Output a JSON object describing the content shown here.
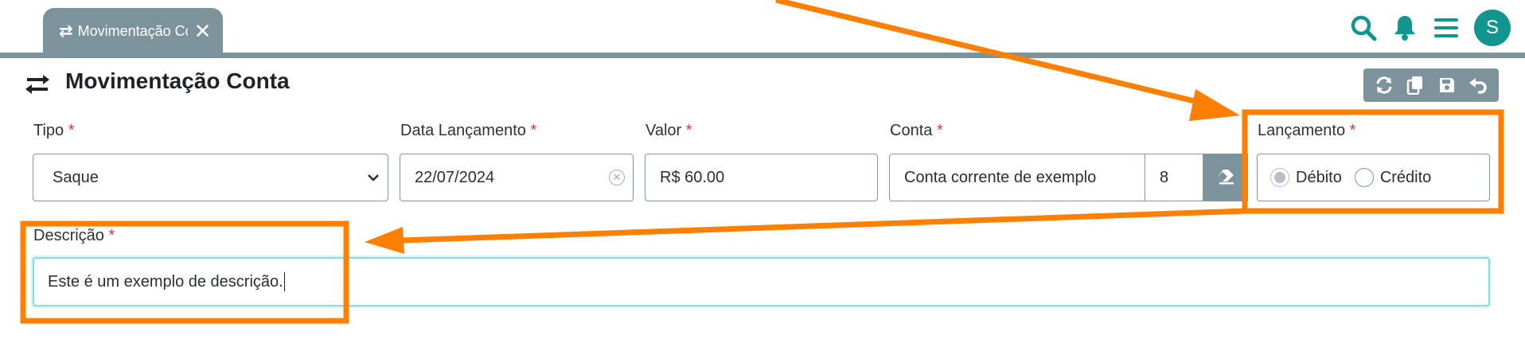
{
  "tab": {
    "label": "Movimentação Conta",
    "close": "✕"
  },
  "top_icons": [
    "search-icon",
    "bell-icon",
    "menu-icon"
  ],
  "user": {
    "avatar_letter": "S"
  },
  "page": {
    "title": "Movimentação Conta",
    "icon": "transfer-arrows-icon"
  },
  "toolbar": [
    "refresh-icon",
    "copy-icon",
    "save-icon",
    "undo-icon"
  ],
  "form": {
    "tipo": {
      "label": "Tipo",
      "value": "Saque"
    },
    "data_lancamento": {
      "label": "Data Lançamento",
      "value": "22/07/2024"
    },
    "valor": {
      "label": "Valor",
      "value": "R$ 60.00"
    },
    "conta": {
      "label": "Conta",
      "value": "Conta corrente de exemplo",
      "code": "8"
    },
    "lancamento": {
      "label": "Lançamento",
      "options": [
        "Débito",
        "Crédito"
      ],
      "selected": "Débito"
    },
    "descricao": {
      "label": "Descrição",
      "value": "Este é um exemplo de descrição."
    },
    "required_mark": "*"
  },
  "colors": {
    "accent": "#11958e",
    "tab_bar": "#7d939b",
    "annotation": "#ff8000",
    "required": "#dc3545",
    "focus_border": "#7fe1da"
  }
}
